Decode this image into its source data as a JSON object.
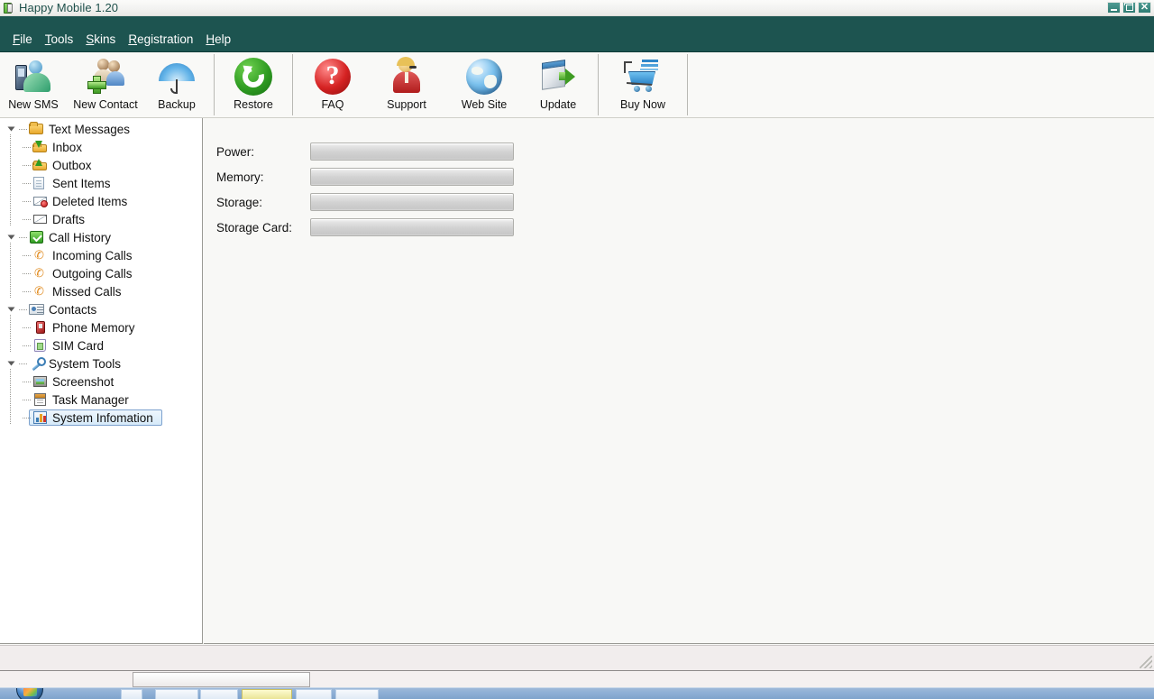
{
  "window": {
    "title": "Happy Mobile 1.20",
    "icon": "app-icon",
    "buttons": {
      "minimize": "minimize",
      "maximize": "maximize",
      "close": "close"
    }
  },
  "menu": {
    "items": [
      {
        "label": "File",
        "mnemonic": "F",
        "rest": "ile"
      },
      {
        "label": "Tools",
        "mnemonic": "T",
        "rest": "ools"
      },
      {
        "label": "Skins",
        "mnemonic": "S",
        "rest": "kins"
      },
      {
        "label": "Registration",
        "mnemonic": "R",
        "rest": "egistration"
      },
      {
        "label": "Help",
        "mnemonic": "H",
        "rest": "elp"
      }
    ]
  },
  "toolbar": {
    "buttons": [
      {
        "label": "New SMS",
        "icon": "new-sms-icon"
      },
      {
        "label": "New Contact",
        "icon": "new-contact-icon"
      },
      {
        "label": "Backup",
        "icon": "umbrella-backup-icon"
      },
      {
        "label": "Restore",
        "icon": "restore-refresh-icon"
      },
      {
        "label": "FAQ",
        "icon": "question-mark-icon"
      },
      {
        "label": "Support",
        "icon": "support-agent-icon"
      },
      {
        "label": "Web Site",
        "icon": "globe-icon"
      },
      {
        "label": "Update",
        "icon": "update-download-icon"
      },
      {
        "label": "Buy Now",
        "icon": "shopping-cart-icon"
      }
    ]
  },
  "sidebar": {
    "nodes": [
      {
        "label": "Text Messages",
        "level": 1,
        "icon": "folder-icon",
        "expander": true,
        "selected": false
      },
      {
        "label": "Inbox",
        "level": 2,
        "icon": "arrow-down-icon",
        "expander": false,
        "selected": false
      },
      {
        "label": "Outbox",
        "level": 2,
        "icon": "arrow-up-icon",
        "expander": false,
        "selected": false
      },
      {
        "label": "Sent Items",
        "level": 2,
        "icon": "sent-page-icon",
        "expander": false,
        "selected": false
      },
      {
        "label": "Deleted Items",
        "level": 2,
        "icon": "deleted-mail-icon",
        "expander": false,
        "selected": false
      },
      {
        "label": "Drafts",
        "level": 2,
        "icon": "draft-envelope-icon",
        "expander": false,
        "selected": false
      },
      {
        "label": "Call History",
        "level": 1,
        "icon": "green-check-icon",
        "expander": true,
        "selected": false
      },
      {
        "label": "Incoming Calls",
        "level": 2,
        "icon": "phone-handset-icon",
        "expander": false,
        "selected": false
      },
      {
        "label": "Outgoing Calls",
        "level": 2,
        "icon": "phone-handset-icon",
        "expander": false,
        "selected": false
      },
      {
        "label": "Missed Calls",
        "level": 2,
        "icon": "phone-handset-icon",
        "expander": false,
        "selected": false
      },
      {
        "label": "Contacts",
        "level": 1,
        "icon": "contact-card-icon",
        "expander": true,
        "selected": false
      },
      {
        "label": "Phone Memory",
        "level": 2,
        "icon": "cellphone-icon",
        "expander": false,
        "selected": false
      },
      {
        "label": "SIM Card",
        "level": 2,
        "icon": "sim-card-icon",
        "expander": false,
        "selected": false
      },
      {
        "label": "System Tools",
        "level": 1,
        "icon": "wrench-icon",
        "expander": true,
        "selected": false
      },
      {
        "label": "Screenshot",
        "level": 2,
        "icon": "screenshot-icon",
        "expander": false,
        "selected": false
      },
      {
        "label": "Task Manager",
        "level": 2,
        "icon": "task-manager-icon",
        "expander": false,
        "selected": false
      },
      {
        "label": "System Infomation",
        "level": 2,
        "icon": "system-info-icon",
        "expander": false,
        "selected": true
      }
    ]
  },
  "main": {
    "rows": [
      {
        "label": "Power:",
        "value": "",
        "percent": 0
      },
      {
        "label": "Memory:",
        "value": "",
        "percent": 0
      },
      {
        "label": "Storage:",
        "value": "",
        "percent": 0
      },
      {
        "label": "Storage Card:",
        "value": "",
        "percent": 0
      }
    ]
  },
  "status_bar": {
    "text": ""
  },
  "tray": {
    "input_value": "",
    "input_placeholder": ""
  },
  "taskbar": {
    "start_label": "Start",
    "tasks": [
      {
        "label": "",
        "state": "plain"
      },
      {
        "label": "",
        "state": "plain"
      },
      {
        "label": "",
        "state": "plain"
      },
      {
        "label": "",
        "state": "active"
      },
      {
        "label": "",
        "state": "plain"
      },
      {
        "label": "",
        "state": "plain"
      }
    ]
  },
  "colors": {
    "menu_bar": "#1d5450",
    "title_text": "#1d4f4a",
    "selection_border": "#7da2ce",
    "selection_fill": "#d6eaf9",
    "taskbar": "#8fb0d6"
  }
}
